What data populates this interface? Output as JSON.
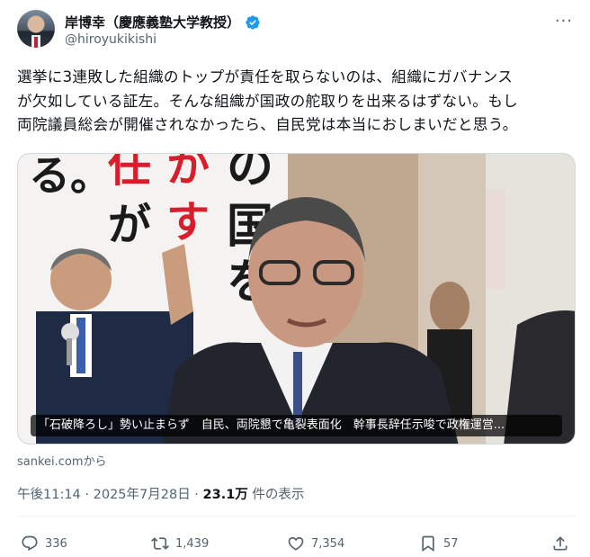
{
  "author": {
    "display_name": "岸博幸（慶應義塾大学教授）",
    "handle": "@hiroyukikishi",
    "verified": true
  },
  "tweet": {
    "text": "選挙に3連敗した組織のトップが責任を取らないのは、組織にガバナンス\nが欠如している証左。そんな組織が国政の舵取りを出来るはずない。もし\n両院議員総会が開催されなかったら、自民党は本当におしまいだと思う。"
  },
  "media": {
    "poster_text": [
      "る。",
      "任",
      "か",
      "が",
      "す",
      "の",
      "国",
      "を"
    ],
    "caption": "「石破降ろし」勢い止まらず　自民、両院懇で亀裂表面化　幹事長辞任示唆で政権運営..."
  },
  "source": "sankei.comから",
  "meta": {
    "time": "午後11:14 · 2025年7月28日 · ",
    "views_count": "23.1万",
    "views_suffix": " 件の表示"
  },
  "actions": {
    "replies": "336",
    "reposts": "1,439",
    "likes": "7,354",
    "bookmarks": "57"
  },
  "icons": {
    "more": "more-icon",
    "verified": "verified-badge-icon",
    "reply": "reply-icon",
    "repost": "repost-icon",
    "like": "like-icon",
    "bookmark": "bookmark-icon",
    "share": "share-icon"
  },
  "colors": {
    "verified_blue": "#1d9bf0",
    "secondary_text": "#536471",
    "poster_red": "#d81e2c"
  }
}
